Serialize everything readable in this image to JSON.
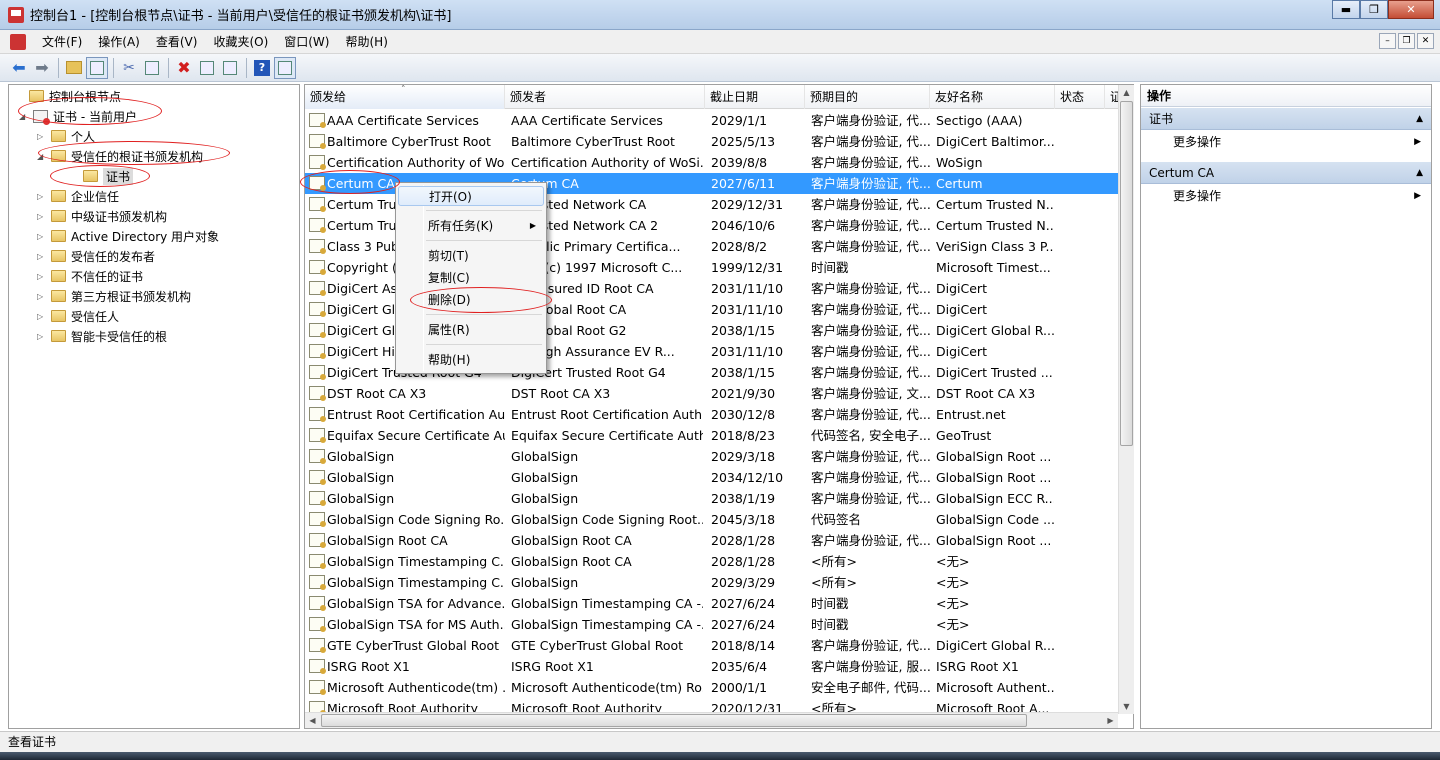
{
  "window": {
    "title": "控制台1 - [控制台根节点\\证书 - 当前用户\\受信任的根证书颁发机构\\证书]",
    "min_glyph": "▬",
    "restore_glyph": "❐",
    "close_glyph": "✕"
  },
  "menu": {
    "items": [
      "文件(F)",
      "操作(A)",
      "查看(V)",
      "收藏夹(O)",
      "窗口(W)",
      "帮助(H)"
    ],
    "mdi": [
      "–",
      "❐",
      "✕"
    ]
  },
  "toolbar": {
    "icons": [
      "back-arrow-icon",
      "forward-arrow-icon",
      "up-folder-icon",
      "show-hide-tree-icon",
      "cut-icon",
      "copy-icon",
      "delete-icon",
      "properties-icon",
      "export-icon",
      "help-icon",
      "action-pane-icon"
    ]
  },
  "tree": {
    "items": [
      {
        "label": "控制台根节点",
        "level": 0,
        "expander": "",
        "kind": "folder"
      },
      {
        "label": "证书 - 当前用户",
        "level": 1,
        "expander": "◢",
        "kind": "store"
      },
      {
        "label": "个人",
        "level": 2,
        "expander": "▷",
        "kind": "folder"
      },
      {
        "label": "受信任的根证书颁发机构",
        "level": 2,
        "expander": "◢",
        "kind": "folder"
      },
      {
        "label": "证书",
        "level": 3,
        "expander": "",
        "kind": "folder",
        "selected": true
      },
      {
        "label": "企业信任",
        "level": 2,
        "expander": "▷",
        "kind": "folder"
      },
      {
        "label": "中级证书颁发机构",
        "level": 2,
        "expander": "▷",
        "kind": "folder"
      },
      {
        "label": "Active Directory 用户对象",
        "level": 2,
        "expander": "▷",
        "kind": "folder"
      },
      {
        "label": "受信任的发布者",
        "level": 2,
        "expander": "▷",
        "kind": "folder"
      },
      {
        "label": "不信任的证书",
        "level": 2,
        "expander": "▷",
        "kind": "folder"
      },
      {
        "label": "第三方根证书颁发机构",
        "level": 2,
        "expander": "▷",
        "kind": "folder"
      },
      {
        "label": "受信任人",
        "level": 2,
        "expander": "▷",
        "kind": "folder"
      },
      {
        "label": "智能卡受信任的根",
        "level": 2,
        "expander": "▷",
        "kind": "folder"
      }
    ]
  },
  "list": {
    "sort_caret": "˄",
    "columns": [
      "颁发给",
      "颁发者",
      "截止日期",
      "预期目的",
      "友好名称",
      "状态",
      "证"
    ],
    "selected_index": 3,
    "rows": [
      [
        "AAA Certificate Services",
        "AAA Certificate Services",
        "2029/1/1",
        "客户端身份验证, 代...",
        "Sectigo (AAA)"
      ],
      [
        "Baltimore CyberTrust Root",
        "Baltimore CyberTrust Root",
        "2025/5/13",
        "客户端身份验证, 代...",
        "DigiCert Baltimor..."
      ],
      [
        "Certification Authority of Wo...",
        "Certification Authority of WoSi...",
        "2039/8/8",
        "客户端身份验证, 代...",
        "WoSign"
      ],
      [
        "Certum CA",
        "Certum CA",
        "2027/6/11",
        "客户端身份验证, 代...",
        "Certum"
      ],
      [
        "Certum Tru",
        "n Trusted Network CA",
        "2029/12/31",
        "客户端身份验证, 代...",
        "Certum Trusted N..."
      ],
      [
        "Certum Tru",
        "n Trusted Network CA 2",
        "2046/10/6",
        "客户端身份验证, 代...",
        "Certum Trusted N..."
      ],
      [
        "Class 3 Pub",
        "3 Public Primary Certifica...",
        "2028/8/2",
        "客户端身份验证, 代...",
        "VeriSign Class 3 P..."
      ],
      [
        "Copyright (",
        "right (c) 1997 Microsoft C...",
        "1999/12/31",
        "时间戳",
        "Microsoft Timest..."
      ],
      [
        "DigiCert As",
        "ert Assured ID Root CA",
        "2031/11/10",
        "客户端身份验证, 代...",
        "DigiCert"
      ],
      [
        "DigiCert Glo",
        "ert Global Root CA",
        "2031/11/10",
        "客户端身份验证, 代...",
        "DigiCert"
      ],
      [
        "DigiCert Glo",
        "ert Global Root G2",
        "2038/1/15",
        "客户端身份验证, 代...",
        "DigiCert Global R..."
      ],
      [
        "DigiCert Hig",
        "ert High Assurance EV R...",
        "2031/11/10",
        "客户端身份验证, 代...",
        "DigiCert"
      ],
      [
        "DigiCert Trusted Root G4",
        "DigiCert Trusted Root G4",
        "2038/1/15",
        "客户端身份验证, 代...",
        "DigiCert Trusted ..."
      ],
      [
        "DST Root CA X3",
        "DST Root CA X3",
        "2021/9/30",
        "客户端身份验证, 文...",
        "DST Root CA X3"
      ],
      [
        "Entrust Root Certification Au...",
        "Entrust Root Certification Auth...",
        "2030/12/8",
        "客户端身份验证, 代...",
        "Entrust.net"
      ],
      [
        "Equifax Secure Certificate Au...",
        "Equifax Secure Certificate Auth...",
        "2018/8/23",
        "代码签名, 安全电子...",
        "GeoTrust"
      ],
      [
        "GlobalSign",
        "GlobalSign",
        "2029/3/18",
        "客户端身份验证, 代...",
        "GlobalSign Root ..."
      ],
      [
        "GlobalSign",
        "GlobalSign",
        "2034/12/10",
        "客户端身份验证, 代...",
        "GlobalSign Root ..."
      ],
      [
        "GlobalSign",
        "GlobalSign",
        "2038/1/19",
        "客户端身份验证, 代...",
        "GlobalSign ECC R..."
      ],
      [
        "GlobalSign Code Signing Ro...",
        "GlobalSign Code Signing Root...",
        "2045/3/18",
        "代码签名",
        "GlobalSign Code ..."
      ],
      [
        "GlobalSign Root CA",
        "GlobalSign Root CA",
        "2028/1/28",
        "客户端身份验证, 代...",
        "GlobalSign Root ..."
      ],
      [
        "GlobalSign Timestamping C...",
        "GlobalSign Root CA",
        "2028/1/28",
        "<所有>",
        "<无>"
      ],
      [
        "GlobalSign Timestamping C...",
        "GlobalSign",
        "2029/3/29",
        "<所有>",
        "<无>"
      ],
      [
        "GlobalSign TSA for Advance...",
        "GlobalSign Timestamping CA -...",
        "2027/6/24",
        "时间戳",
        "<无>"
      ],
      [
        "GlobalSign TSA for MS Auth...",
        "GlobalSign Timestamping CA -...",
        "2027/6/24",
        "时间戳",
        "<无>"
      ],
      [
        "GTE CyberTrust Global Root",
        "GTE CyberTrust Global Root",
        "2018/8/14",
        "客户端身份验证, 代...",
        "DigiCert Global R..."
      ],
      [
        "ISRG Root X1",
        "ISRG Root X1",
        "2035/6/4",
        "客户端身份验证, 服...",
        "ISRG Root X1"
      ],
      [
        "Microsoft Authenticode(tm) ...",
        "Microsoft Authenticode(tm) Ro...",
        "2000/1/1",
        "安全电子邮件, 代码...",
        "Microsoft Authent..."
      ],
      [
        "Microsoft Root Authority",
        "Microsoft Root Authority",
        "2020/12/31",
        "<所有>",
        "Microsoft Root A..."
      ]
    ]
  },
  "context_menu": {
    "items": [
      {
        "label": "打开(O)",
        "highlight": true
      },
      {
        "label": "所有任务(K)",
        "submenu": true,
        "submenu_glyph": "▶"
      },
      {
        "label": "剪切(T)"
      },
      {
        "label": "复制(C)"
      },
      {
        "label": "删除(D)"
      },
      {
        "label": "属性(R)"
      },
      {
        "label": "帮助(H)"
      }
    ]
  },
  "actions": {
    "title": "操作",
    "sections": [
      {
        "title": "证书",
        "item": "更多操作"
      },
      {
        "title": "Certum CA",
        "item": "更多操作"
      }
    ],
    "caret_glyph": "▲",
    "arrow_glyph": "▶"
  },
  "status": {
    "text": "查看证书"
  }
}
